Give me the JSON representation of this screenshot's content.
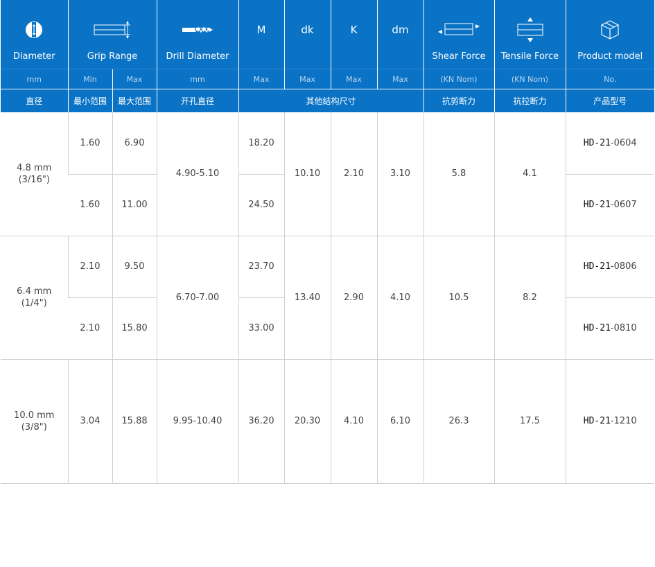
{
  "columns": [
    {
      "label": "Diameter",
      "unit": "mm",
      "cn": "直径",
      "icon": "rivet-diameter-icon"
    },
    {
      "label": "Grip Range",
      "sub": [
        "Min",
        "Max"
      ],
      "cn": [
        "最小范围",
        "最大范围"
      ],
      "icon": "grip-range-icon"
    },
    {
      "label": "Drill Diameter",
      "unit": "mm",
      "cn": "开孔直径",
      "icon": "drill-bit-icon"
    },
    {
      "symbol": "M",
      "unit": "Max"
    },
    {
      "symbol": "dk",
      "unit": "Max"
    },
    {
      "symbol": "K",
      "unit": "Max"
    },
    {
      "symbol": "dm",
      "unit": "Max"
    },
    {
      "label": "Shear Force",
      "unit": "(KN Nom)",
      "cn": "抗剪断力",
      "icon": "shear-force-icon"
    },
    {
      "label": "Tensile Force",
      "unit": "(KN Nom)",
      "cn": "抗拉断力",
      "icon": "tensile-force-icon"
    },
    {
      "label": "Product model",
      "unit": "No.",
      "cn": "产品型号",
      "icon": "product-box-icon"
    }
  ],
  "structure_cn": "其他结构尺寸",
  "groups": [
    {
      "diameter": "4.8 mm",
      "diameter_inch": "(3/16\")",
      "drill": "4.90-5.10",
      "dk": "10.10",
      "k": "2.10",
      "dm": "3.10",
      "shear": "5.8",
      "tensile": "4.1",
      "rows": [
        {
          "min": "1.60",
          "max": "6.90",
          "m": "18.20",
          "model_prefix": "HD-21",
          "model_suffix": "-0604"
        },
        {
          "min": "1.60",
          "max": "11.00",
          "m": "24.50",
          "model_prefix": "HD-21",
          "model_suffix": "-0607"
        }
      ]
    },
    {
      "diameter": "6.4 mm",
      "diameter_inch": "(1/4\")",
      "drill": "6.70-7.00",
      "dk": "13.40",
      "k": "2.90",
      "dm": "4.10",
      "shear": "10.5",
      "tensile": "8.2",
      "rows": [
        {
          "min": "2.10",
          "max": "9.50",
          "m": "23.70",
          "model_prefix": "HD-21",
          "model_suffix": "-0806"
        },
        {
          "min": "2.10",
          "max": "15.80",
          "m": "33.00",
          "model_prefix": "HD-21",
          "model_suffix": "-0810"
        }
      ]
    },
    {
      "diameter": "10.0 mm",
      "diameter_inch": "(3/8\")",
      "drill": "9.95-10.40",
      "dk": "20.30",
      "k": "4.10",
      "dm": "6.10",
      "shear": "26.3",
      "tensile": "17.5",
      "rows": [
        {
          "min": "3.04",
          "max": "15.88",
          "m": "36.20",
          "model_prefix": "HD-21",
          "model_suffix": "-1210"
        }
      ]
    }
  ]
}
